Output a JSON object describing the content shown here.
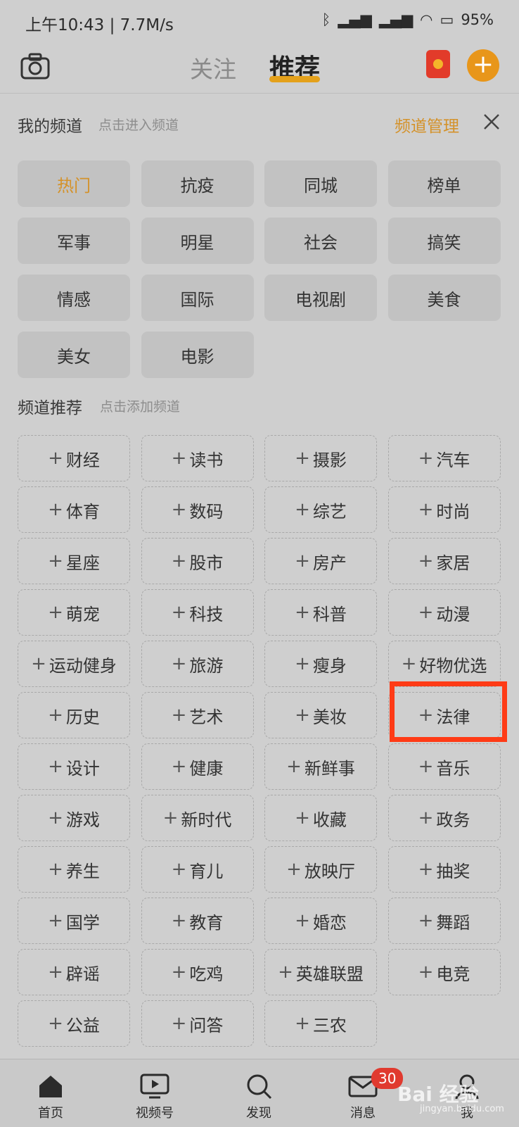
{
  "status": {
    "time": "上午10:43 | 7.7M/s",
    "battery": "95%"
  },
  "header": {
    "tab_follow": "关注",
    "tab_recommend": "推荐"
  },
  "my_channels": {
    "title": "我的频道",
    "hint": "点击进入频道",
    "manage": "频道管理",
    "items": [
      "热门",
      "抗疫",
      "同城",
      "榜单",
      "军事",
      "明星",
      "社会",
      "搞笑",
      "情感",
      "国际",
      "电视剧",
      "美食",
      "美女",
      "电影"
    ]
  },
  "recommended": {
    "title": "频道推荐",
    "hint": "点击添加频道",
    "plus": "+",
    "items": [
      "财经",
      "读书",
      "摄影",
      "汽车",
      "体育",
      "数码",
      "综艺",
      "时尚",
      "星座",
      "股市",
      "房产",
      "家居",
      "萌宠",
      "科技",
      "科普",
      "动漫",
      "运动健身",
      "旅游",
      "瘦身",
      "好物优选",
      "历史",
      "艺术",
      "美妆",
      "法律",
      "设计",
      "健康",
      "新鲜事",
      "音乐",
      "游戏",
      "新时代",
      "收藏",
      "政务",
      "养生",
      "育儿",
      "放映厅",
      "抽奖",
      "国学",
      "教育",
      "婚恋",
      "舞蹈",
      "辟谣",
      "吃鸡",
      "英雄联盟",
      "电竞",
      "公益",
      "问答",
      "三农"
    ]
  },
  "nav": {
    "home": "首页",
    "video": "视频号",
    "discover": "发现",
    "message": "消息",
    "me": "我",
    "badge": "30"
  },
  "watermark": {
    "brand": "Bai 经验",
    "url": "jingyan.baidu.com"
  },
  "colors": {
    "accent": "#e4a11b",
    "highlight": "#ff3b16"
  }
}
